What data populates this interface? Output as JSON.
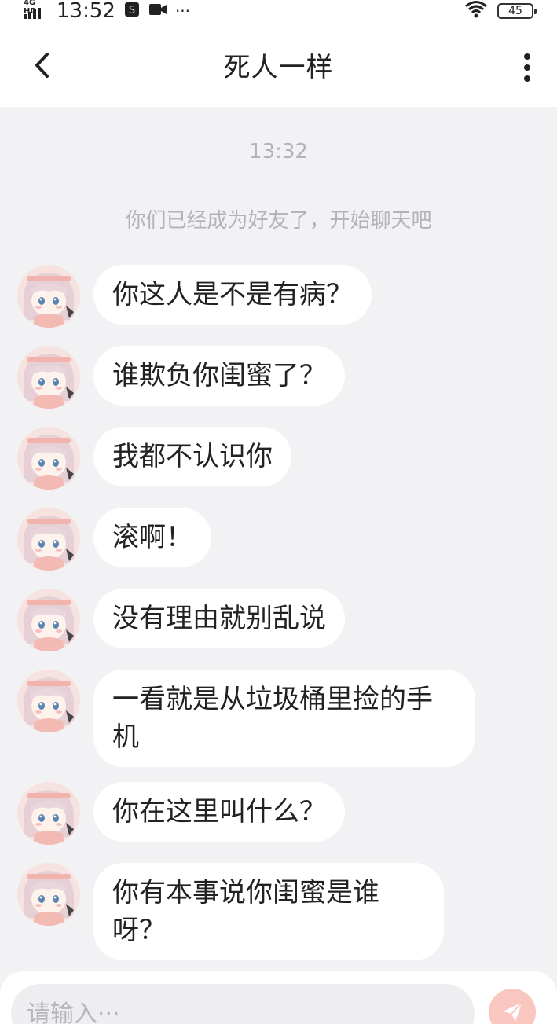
{
  "status_bar": {
    "network": "4G HD",
    "time": "13:52",
    "icons": [
      "signal-icon",
      "s-app-icon",
      "video-icon",
      "more-dots-icon",
      "wifi-icon",
      "battery-icon"
    ],
    "overflow": "···",
    "battery": "45"
  },
  "header": {
    "title": "死人一样",
    "back_icon": "chevron-left-icon",
    "menu_icon": "vertical-dots-icon"
  },
  "chat": {
    "timestamp": "13:32",
    "system_notice": "你们已经成为好友了，开始聊天吧",
    "messages": [
      {
        "text": "你这人是不是有病？"
      },
      {
        "text": "谁欺负你闺蜜了？"
      },
      {
        "text": "我都不认识你"
      },
      {
        "text": "滚啊！"
      },
      {
        "text": "没有理由就别乱说"
      },
      {
        "text": "一看就是从垃圾桶里捡的手机"
      },
      {
        "text": "你在这里叫什么？"
      },
      {
        "text": "你有本事说你闺蜜是谁呀？"
      }
    ]
  },
  "composer": {
    "placeholder": "请输入···",
    "send_icon": "paper-plane-icon"
  },
  "colors": {
    "background": "#f2f2f4",
    "bubble": "#ffffff",
    "send_button": "#f9c7bf",
    "muted_text": "#b3b3b6"
  }
}
